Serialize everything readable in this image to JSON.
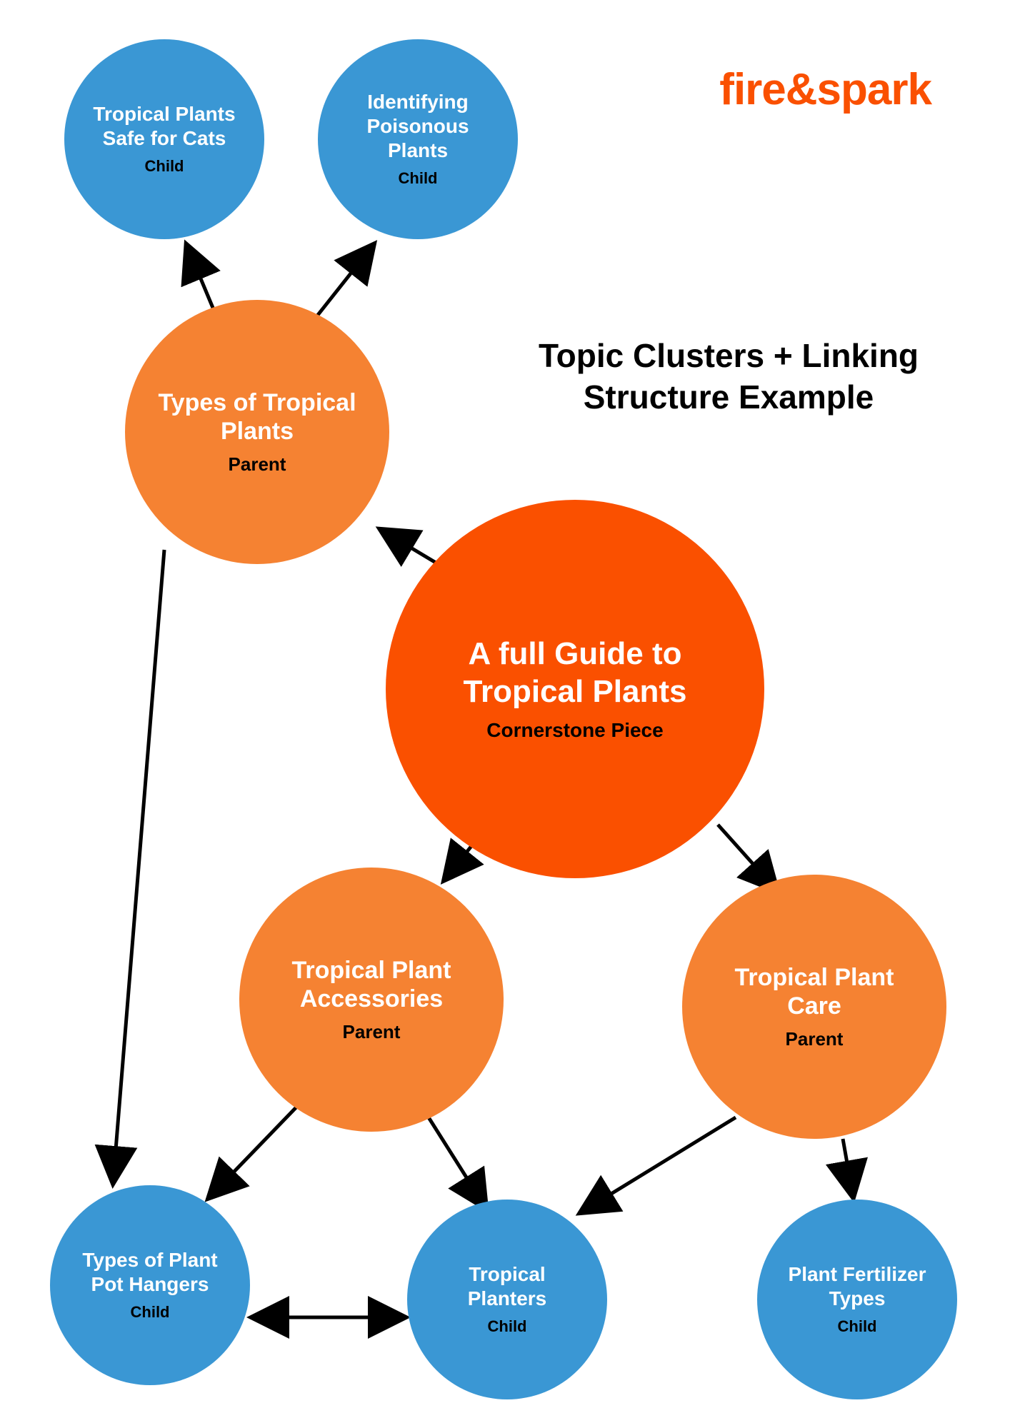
{
  "logo": "fire&spark",
  "heading": "Topic Clusters + Linking Structure Example",
  "labels": {
    "cornerstone": "Cornerstone Piece",
    "parent": "Parent",
    "child": "Child"
  },
  "nodes": {
    "cornerstone": {
      "title": "A full Guide to Tropical Plants",
      "role": "Cornerstone Piece"
    },
    "parent_types": {
      "title": "Types of Tropical Plants",
      "role": "Parent"
    },
    "parent_accessories": {
      "title": "Tropical Plant Accessories",
      "role": "Parent"
    },
    "parent_care": {
      "title": "Tropical Plant Care",
      "role": "Parent"
    },
    "child_cats": {
      "title": "Tropical Plants Safe for Cats",
      "role": "Child"
    },
    "child_poison": {
      "title": "Identifying Poisonous Plants",
      "role": "Child"
    },
    "child_hangers": {
      "title": "Types of Plant Pot Hangers",
      "role": "Child"
    },
    "child_planters": {
      "title": "Tropical Planters",
      "role": "Child"
    },
    "child_fertilizer": {
      "title": "Plant Fertilizer Types",
      "role": "Child"
    }
  },
  "edges": [
    {
      "from": "cornerstone",
      "to": "parent_types",
      "double": false
    },
    {
      "from": "cornerstone",
      "to": "parent_accessories",
      "double": false
    },
    {
      "from": "cornerstone",
      "to": "parent_care",
      "double": false
    },
    {
      "from": "parent_types",
      "to": "child_cats",
      "double": false
    },
    {
      "from": "parent_types",
      "to": "child_poison",
      "double": false
    },
    {
      "from": "parent_types",
      "to": "child_hangers",
      "double": false
    },
    {
      "from": "parent_accessories",
      "to": "child_hangers",
      "double": false
    },
    {
      "from": "parent_accessories",
      "to": "child_planters",
      "double": false
    },
    {
      "from": "parent_care",
      "to": "child_planters",
      "double": false
    },
    {
      "from": "parent_care",
      "to": "child_fertilizer",
      "double": false
    },
    {
      "from": "child_hangers",
      "to": "child_planters",
      "double": true
    }
  ]
}
